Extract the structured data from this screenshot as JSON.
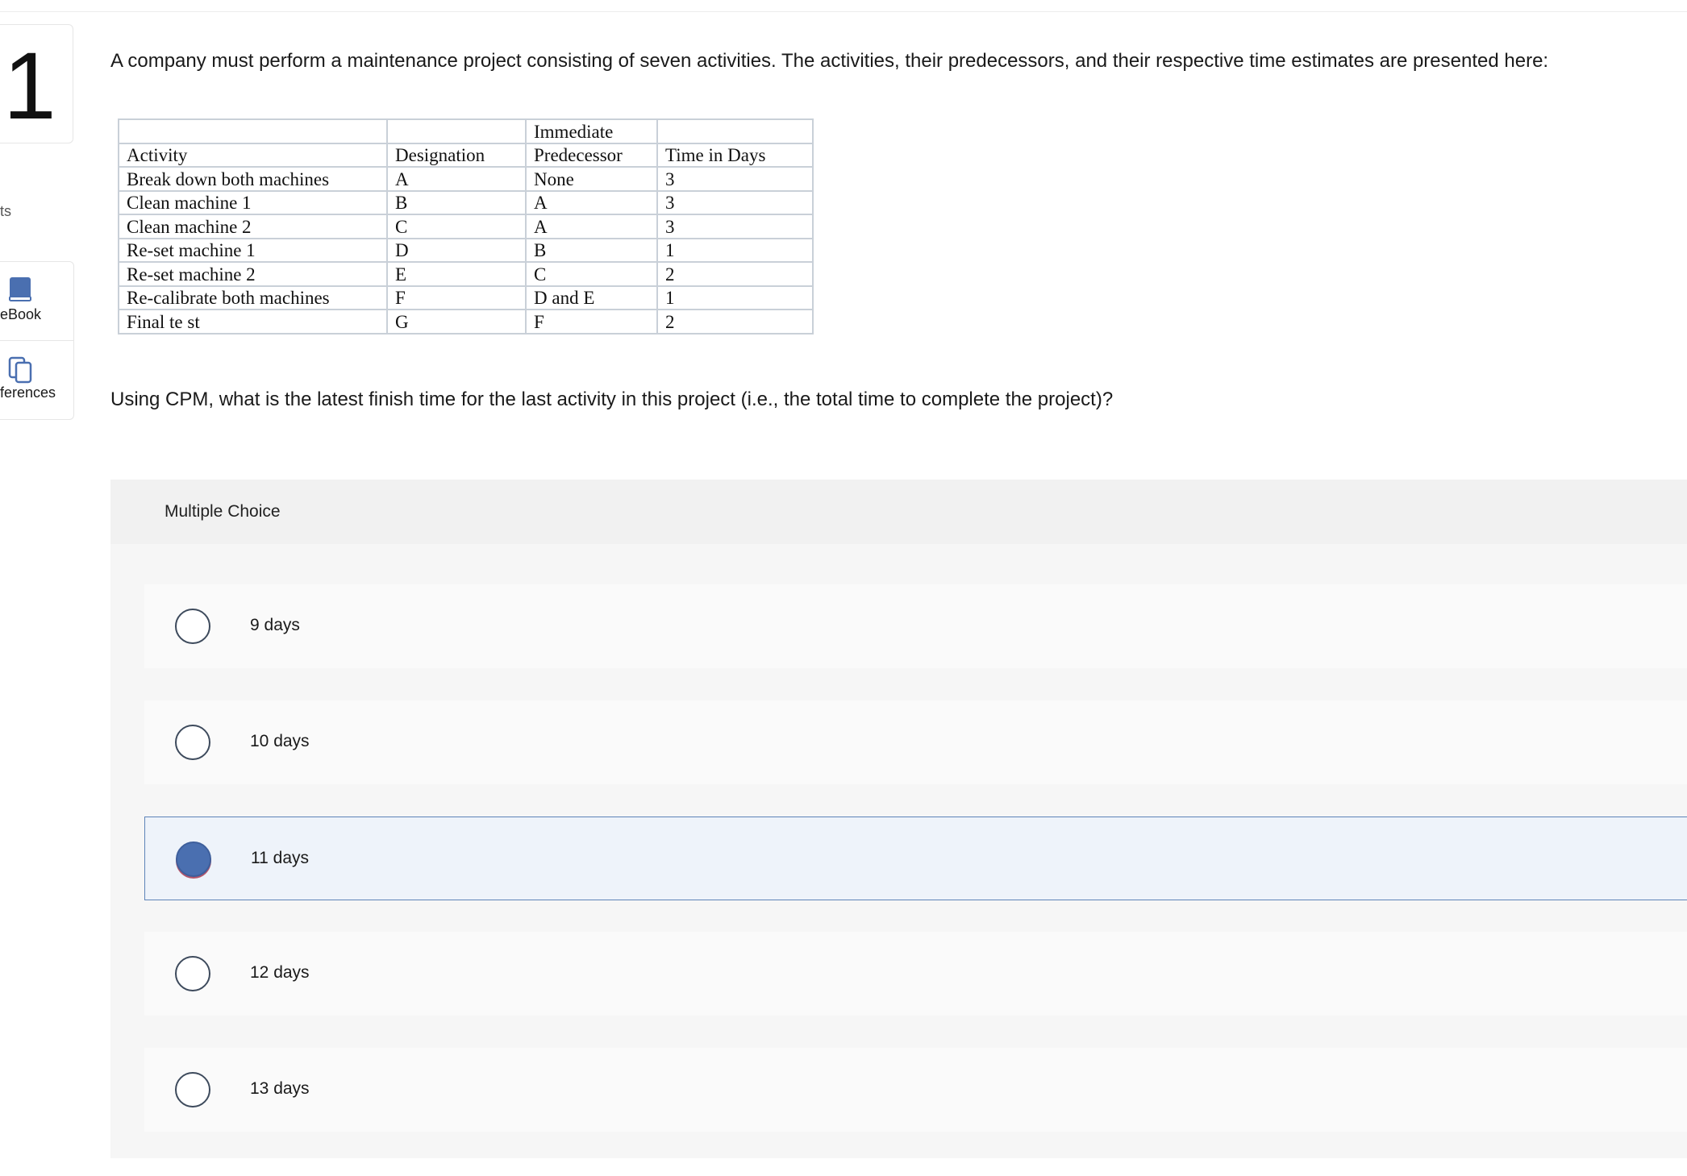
{
  "question_number": "1",
  "sidebar": {
    "points_fragment": "ts",
    "ebook_label": "eBook",
    "references_label": "ferences"
  },
  "prompt": "A company must perform a maintenance project consisting of seven activities. The activities, their predecessors, and their respective time estimates are presented here:",
  "table": {
    "header_top": [
      "",
      "",
      "Immediate",
      ""
    ],
    "header": [
      "Activity",
      "Designation",
      "Predecessor",
      "Time in Days"
    ],
    "rows": [
      [
        "Break down both machines",
        "A",
        "None",
        "3"
      ],
      [
        "Clean machine 1",
        "B",
        "A",
        "3"
      ],
      [
        "Clean machine 2",
        "C",
        "A",
        "3"
      ],
      [
        "Re-set machine 1",
        "D",
        "B",
        "1"
      ],
      [
        "Re-set machine 2",
        "E",
        "C",
        "2"
      ],
      [
        "Re-calibrate both machines",
        "F",
        "D and E",
        "1"
      ],
      [
        "Final te st",
        "G",
        "F",
        "2"
      ]
    ]
  },
  "question": "Using CPM, what is the latest finish time for the last activity in this project (i.e., the total time to complete the project)?",
  "multiple_choice": {
    "title": "Multiple Choice",
    "selected_index": 2,
    "options": [
      "9 days",
      "10 days",
      "11 days",
      "12 days",
      "13 days"
    ]
  },
  "colors": {
    "selected_fill": "#4a6fb0",
    "selected_border": "#5e84b8",
    "icon_blue": "#4a6fb0"
  }
}
